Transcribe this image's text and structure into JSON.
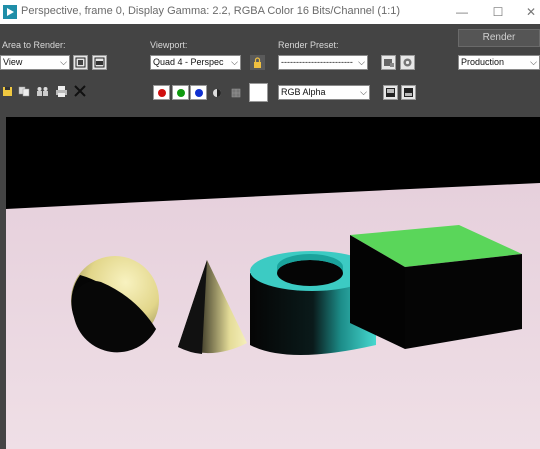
{
  "window": {
    "title": "Perspective, frame 0, Display Gamma: 2.2, RGBA Color 16 Bits/Channel (1:1)",
    "minimize": "—",
    "maximize": "☐",
    "close": "✕"
  },
  "controls": {
    "area_label": "Area to Render:",
    "area_value": "View",
    "viewport_label": "Viewport:",
    "viewport_value": "Quad 4 - Perspec",
    "preset_label": "Render Preset:",
    "preset_value": "------------------------",
    "render_button": "Render",
    "production_value": "Production",
    "channel_value": "RGB Alpha"
  },
  "colors": {
    "toolbar": "#444444",
    "red_channel": "#d01010",
    "green_channel": "#109a10",
    "blue_channel": "#1030d0",
    "sphere": "#e8e0a0",
    "cylinder_side": "#3cc8c0",
    "box_top": "#5ad65a",
    "ground": "#ead8e0"
  },
  "icons": [
    "save-image-icon",
    "copy-image-icon",
    "clone-window-icon",
    "print-icon",
    "clear-icon",
    "lock-icon",
    "mono-channel-icon",
    "toggle-uv-icon",
    "display-alpha-icon",
    "display-channel-icon"
  ]
}
